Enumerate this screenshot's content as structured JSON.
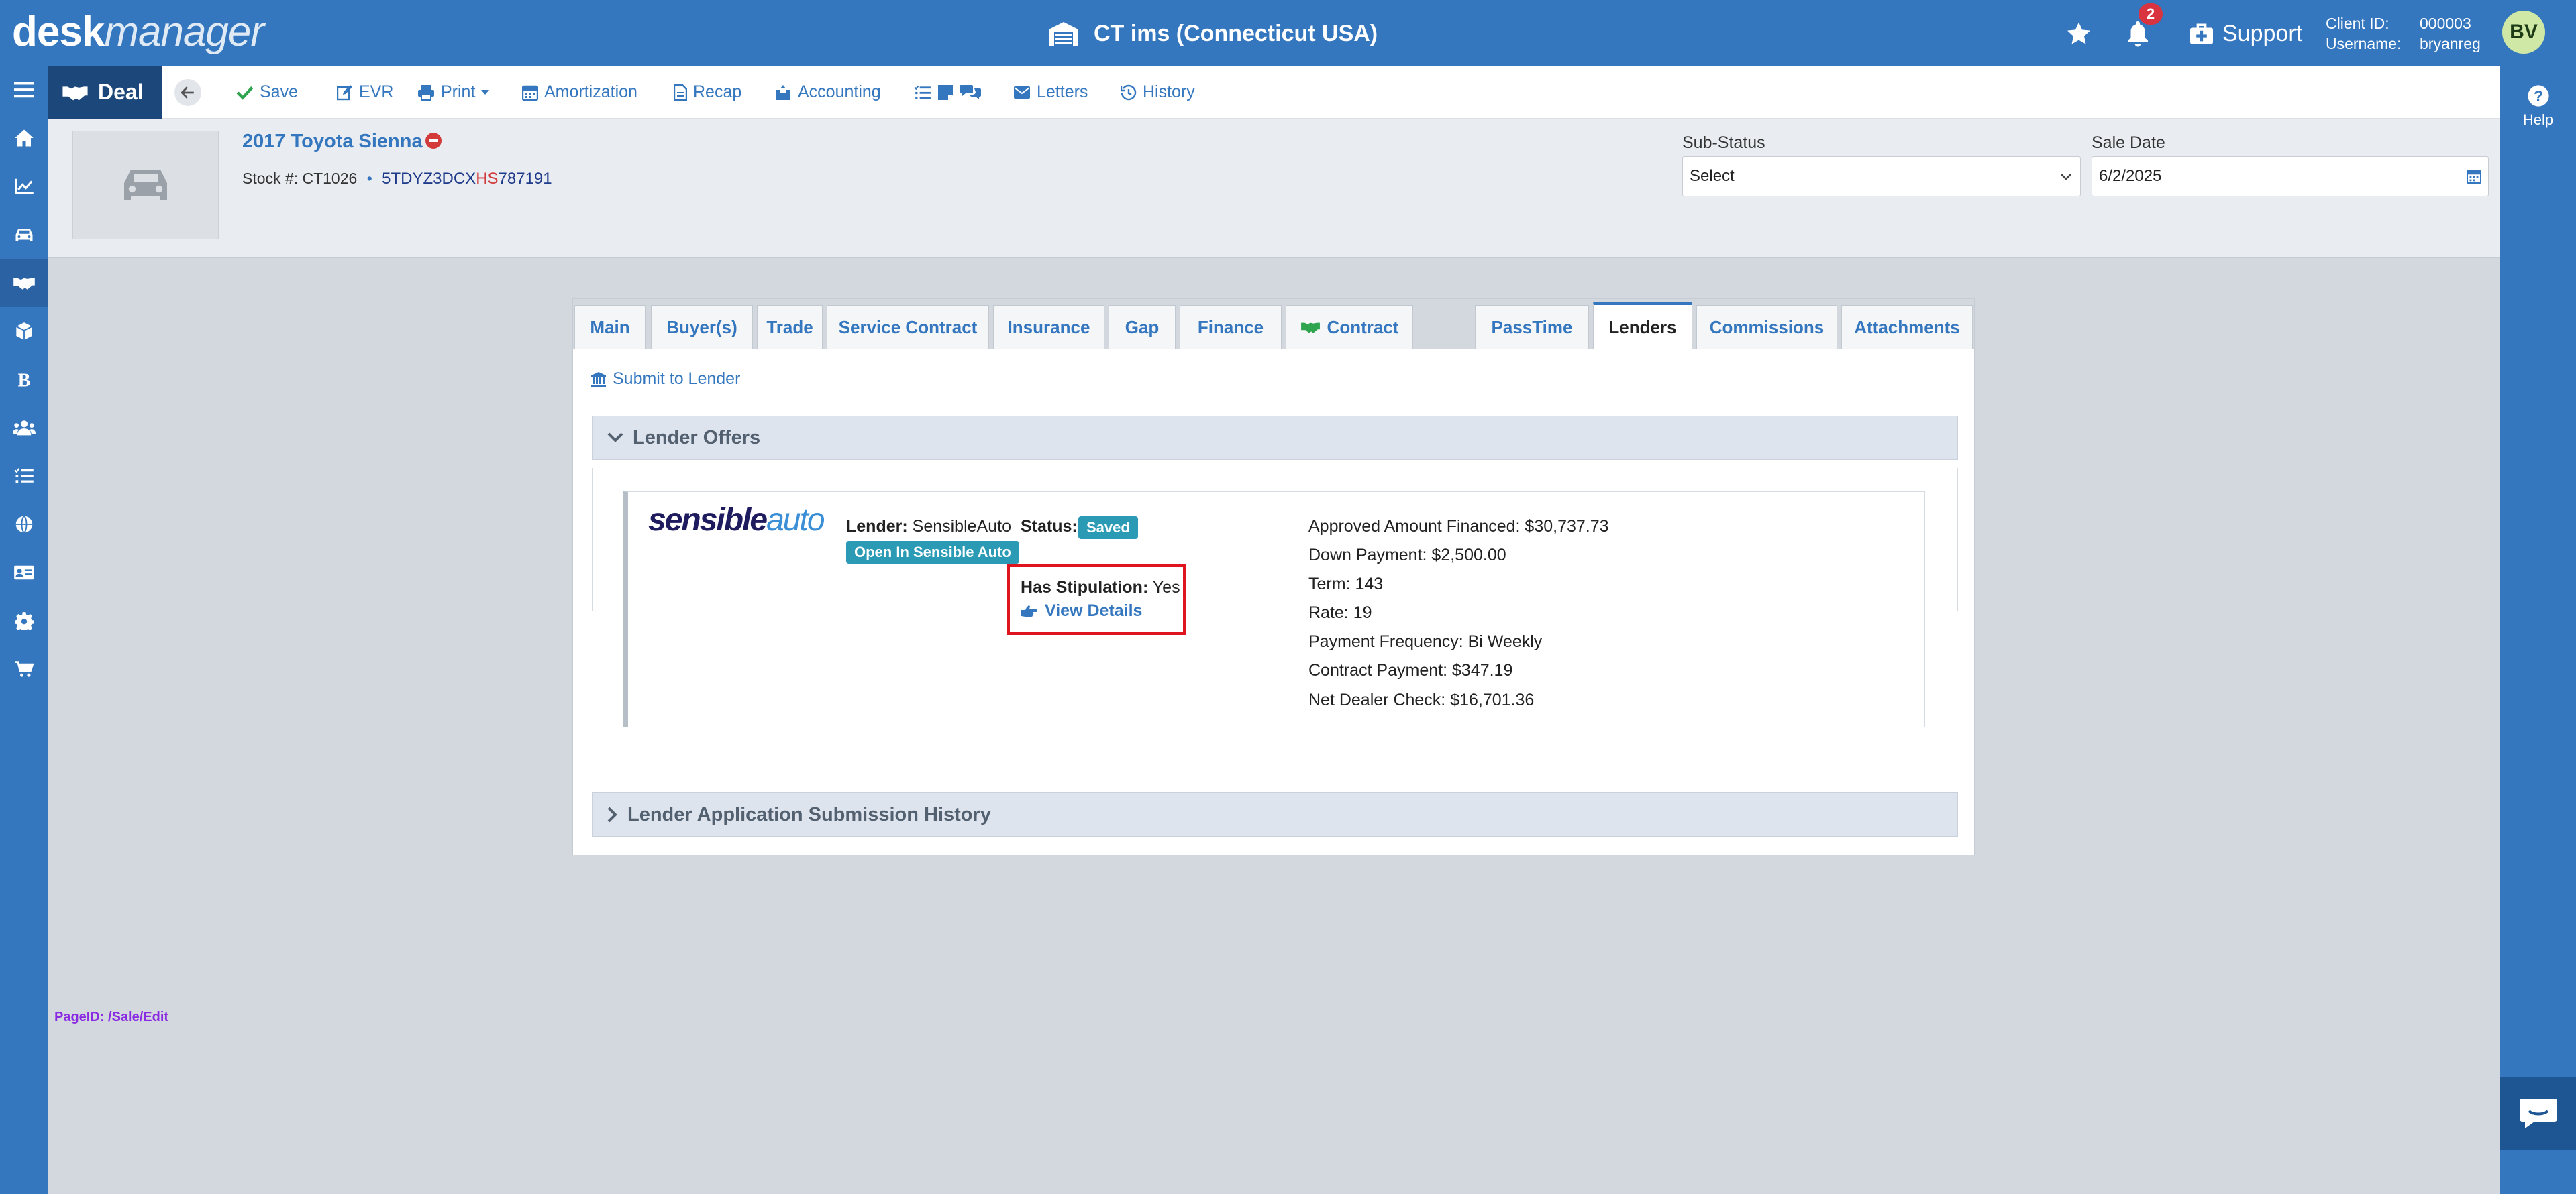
{
  "header": {
    "logo_bold": "desk",
    "logo_italic": "manager",
    "title": "CT ims (Connecticut USA)",
    "notifications_count": "2",
    "support_label": "Support",
    "client_id_label": "Client ID:",
    "client_id_value": "000003",
    "username_label": "Username:",
    "username_value": "bryanreg",
    "avatar_initials": "BV"
  },
  "toolbar": {
    "deal_label": "Deal",
    "save_label": "Save",
    "evr_label": "EVR",
    "print_label": "Print",
    "amortization_label": "Amortization",
    "recap_label": "Recap",
    "accounting_label": "Accounting",
    "letters_label": "Letters",
    "history_label": "History"
  },
  "right_rail": {
    "help_label": "Help"
  },
  "vehicle": {
    "title": "2017 Toyota Sienna",
    "stock_label": "Stock #: CT1026",
    "separator": "•",
    "vin_part1": "5TDYZ3DCX",
    "vin_highlight": "HS",
    "vin_part2": "787191",
    "sub_status_label": "Sub-Status",
    "sub_status_value": "Select",
    "sale_date_label": "Sale Date",
    "sale_date_value": "6/2/2025"
  },
  "tabs": {
    "main": "Main",
    "buyers": "Buyer(s)",
    "trade": "Trade",
    "service_contract": "Service Contract",
    "insurance": "Insurance",
    "gap": "Gap",
    "finance": "Finance",
    "contract": "Contract",
    "passtime": "PassTime",
    "lenders": "Lenders",
    "commissions": "Commissions",
    "attachments": "Attachments"
  },
  "lenders": {
    "submit_label": "Submit to Lender",
    "offers_title": "Lender Offers",
    "history_title": "Lender Application Submission History",
    "offer": {
      "logo_main": "sensible",
      "logo_accent": "auto",
      "lender_label": "Lender:",
      "lender_value": "SensibleAuto",
      "open_button": "Open In Sensible Auto",
      "status_label": "Status:",
      "status_value": "Saved",
      "stipulation_label": "Has Stipulation:",
      "stipulation_value": "Yes",
      "view_details": "View Details",
      "approved_amount": "Approved Amount Financed: $30,737.73",
      "down_payment": "Down Payment: $2,500.00",
      "term": "Term: 143",
      "rate": "Rate: 19",
      "payment_frequency": "Payment Frequency: Bi Weekly",
      "contract_payment": "Contract Payment: $347.19",
      "net_dealer_check": "Net Dealer Check: $16,701.36"
    }
  },
  "footer": {
    "page_id": "PageID:  /Sale/Edit"
  },
  "colors": {
    "brand_blue": "#3477bf",
    "deal_navy": "#1c477a",
    "highlight_red": "#e0141e",
    "pill_teal": "#2b9bb5"
  }
}
